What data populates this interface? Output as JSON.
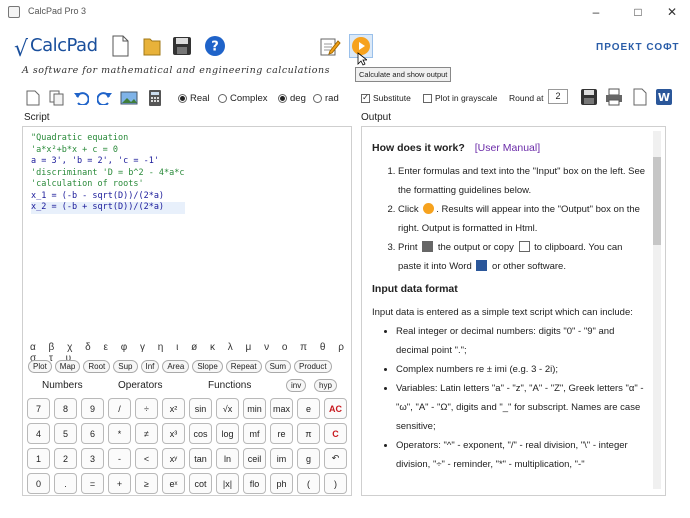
{
  "window": {
    "title": "CalcPad Pro 3",
    "minimize": "–",
    "maximize": "□",
    "close": "✕"
  },
  "header": {
    "logo_text": "CalcPad",
    "subtitle": "A software for mathematical and engineering calculations",
    "brand": "ПРОЕКТ СОФТ",
    "tooltip": "Calculate and show output"
  },
  "toolbar": {
    "mode_real": "Real",
    "mode_complex": "Complex",
    "angle_deg": "deg",
    "angle_rad": "rad",
    "substitute": "Substitute",
    "plot_grayscale": "Plot in grayscale",
    "round_label": "Round at",
    "round_value": "2"
  },
  "script": {
    "label": "Script",
    "lines": [
      {
        "cls": "c",
        "text": "\"Quadratic equation"
      },
      {
        "cls": "c",
        "text": "'a*x<sup>2</sup>+b*x + c = 0"
      },
      {
        "cls": "v",
        "text": "a = 3', 'b = 2', 'c = -1'"
      },
      {
        "cls": "c",
        "text": "'discriminant  'D = b^2 - 4*a*c"
      },
      {
        "cls": "c",
        "text": "'calculation of roots'"
      },
      {
        "cls": "v",
        "text": "x_1 = (-b - sqrt(D))/(2*a)"
      },
      {
        "cls": "v",
        "text": "x_2 = (-b + sqrt(D))/(2*a)"
      }
    ],
    "greek": "α β χ δ ε φ γ η ι ø κ λ μ ν ο π θ ρ σ τ υ",
    "func_buttons": [
      "Plot",
      "Map",
      "Root",
      "Sup",
      "Inf",
      "Area",
      "Slope",
      "Repeat",
      "Sum",
      "Product"
    ],
    "tabs": {
      "numbers": "Numbers",
      "operators": "Operators",
      "functions": "Functions",
      "inv": "inv",
      "hyp": "hyp"
    },
    "keypad": [
      "7",
      "8",
      "9",
      "/",
      "÷",
      "x²",
      "sin",
      "√x",
      "min",
      "max",
      "e",
      "AC",
      "4",
      "5",
      "6",
      "*",
      "≠",
      "x³",
      "cos",
      "log",
      "mf",
      "re",
      "π",
      "C",
      "1",
      "2",
      "3",
      "-",
      "<",
      "xʸ",
      "tan",
      "ln",
      "ceil",
      "im",
      "g",
      "↶",
      "0",
      ".",
      "=",
      "+",
      "≥",
      "eˣ",
      "cot",
      "|x|",
      "flo",
      "ph",
      "(",
      ")"
    ]
  },
  "output": {
    "label": "Output",
    "how_heading": "How does it work?",
    "manual_link": "[User Manual]",
    "steps": [
      "Enter formulas and text into the \"Input\" box on the left. See the formatting guidelines below.",
      "Click . Results will appear into the \"Output\" box on the right. Output is formatted in Html.",
      "Print  the output or copy  to clipboard. You can paste it into Word  or other software."
    ],
    "input_heading": "Input data format",
    "input_intro": "Input data is entered as a simple text script which can include:",
    "bullets": [
      "Real integer or decimal numbers: digits \"0\" - \"9\" and decimal point \".\";",
      "Complex numbers re ± imi (e.g. 3 - 2i);",
      "Variables: Latin letters \"a\" - \"z\", \"A\" - \"Z\", Greek letters \"α\" - \"ω\", \"Α\" - \"Ω\", digits and \"_\" for subscript. Names are case sensitive;",
      "Operators: \"^\" - exponent, \"/\" - real division, \"\\\" - integer division, \"÷\" - reminder, \"*\" - multiplication, \"-\""
    ]
  },
  "colors": {
    "accent": "#1a4f9c",
    "red_key": "#c8181e",
    "comment": "#2a8a3a"
  }
}
